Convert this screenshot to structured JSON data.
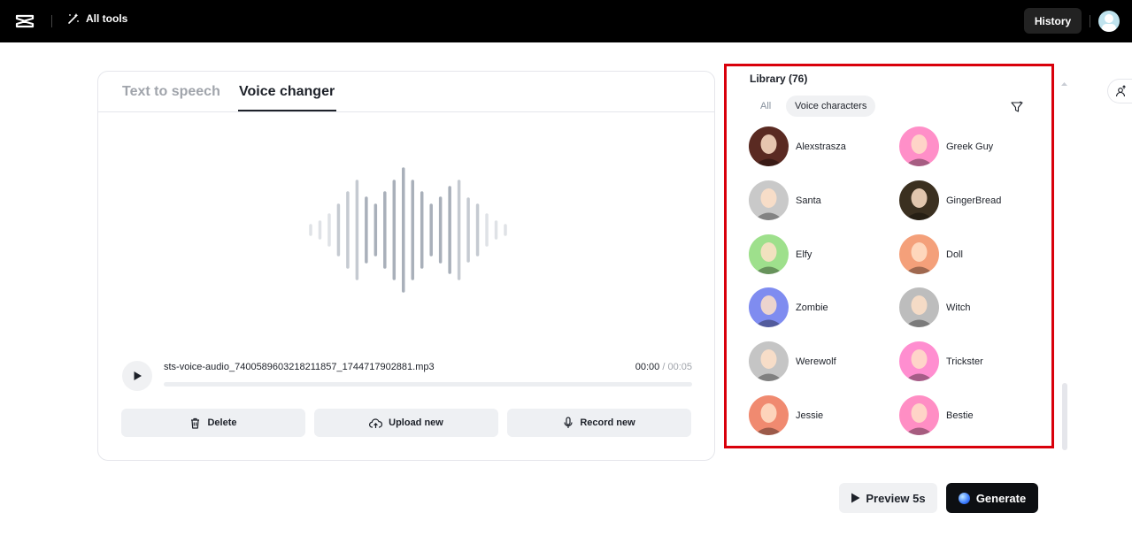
{
  "topbar": {
    "all_tools_label": "All tools",
    "history_label": "History"
  },
  "tabs": {
    "tts_label": "Text to speech",
    "vc_label": "Voice changer",
    "active": "Voice changer"
  },
  "player": {
    "filename": "sts-voice-audio_7400589603218211857_1744717902881.mp3",
    "current_time": "00:00",
    "separator": " / ",
    "total_time": "00:05",
    "progress": 0
  },
  "actions": {
    "delete_label": "Delete",
    "upload_label": "Upload new",
    "record_label": "Record new"
  },
  "library": {
    "title": "Library (76)",
    "filter_all": "All",
    "filter_voice_characters": "Voice characters",
    "active_filter": "Voice characters",
    "voices": [
      {
        "name": "Alexstrasza",
        "color": "#5a2a22"
      },
      {
        "name": "Greek Guy",
        "color": "#ff8fc8"
      },
      {
        "name": "Santa",
        "color": "#c9c9c9"
      },
      {
        "name": "GingerBread",
        "color": "#3b3020"
      },
      {
        "name": "Elfy",
        "color": "#9ee08c"
      },
      {
        "name": "Doll",
        "color": "#f4a07a"
      },
      {
        "name": "Zombie",
        "color": "#7f8cf0"
      },
      {
        "name": "Witch",
        "color": "#bdbdbd"
      },
      {
        "name": "Werewolf",
        "color": "#c5c5c5"
      },
      {
        "name": "Trickster",
        "color": "#ff8ed0"
      },
      {
        "name": "Jessie",
        "color": "#f08a70"
      },
      {
        "name": "Bestie",
        "color": "#ff8ec4"
      }
    ]
  },
  "footer": {
    "preview_label": "Preview 5s",
    "generate_label": "Generate"
  },
  "colors": {
    "topbar_bg": "#000000",
    "highlight_border": "#d9000b",
    "generate_bg": "#0d0f12"
  }
}
